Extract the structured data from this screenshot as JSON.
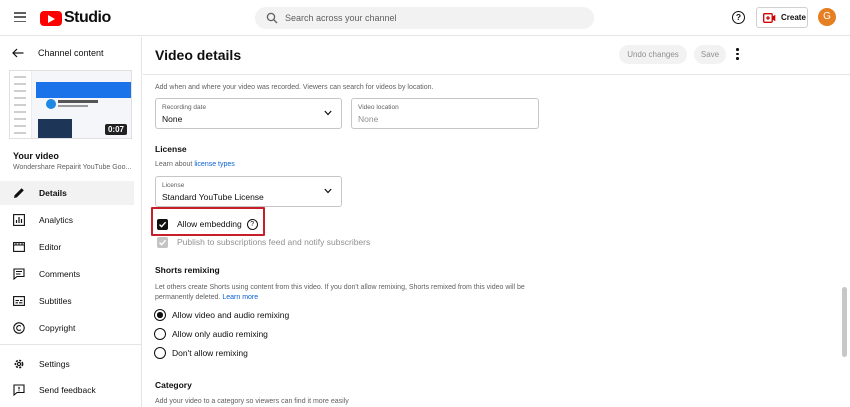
{
  "app": {
    "logo_text": "Studio",
    "search_placeholder": "Search across your channel",
    "create_label": "Create",
    "avatar_letter": "G",
    "help_glyph": "?"
  },
  "sidebar": {
    "back_label": "Channel content",
    "video_duration": "0:07",
    "your_video_label": "Your video",
    "video_name": "Wondershare Repairit YouTube Goo...",
    "items": [
      {
        "label": "Details",
        "icon": "pencil-icon",
        "active": true
      },
      {
        "label": "Analytics",
        "icon": "analytics-icon",
        "active": false
      },
      {
        "label": "Editor",
        "icon": "editor-icon",
        "active": false
      },
      {
        "label": "Comments",
        "icon": "comments-icon",
        "active": false
      },
      {
        "label": "Subtitles",
        "icon": "subtitles-icon",
        "active": false
      },
      {
        "label": "Copyright",
        "icon": "copyright-icon",
        "active": false
      }
    ],
    "footer_items": [
      {
        "label": "Settings",
        "icon": "gear-icon"
      },
      {
        "label": "Send feedback",
        "icon": "feedback-icon"
      }
    ]
  },
  "main": {
    "title": "Video details",
    "undo_label": "Undo changes",
    "save_label": "Save",
    "recording": {
      "description": "Add when and where your video was recorded. Viewers can search for videos by location.",
      "date_label": "Recording date",
      "date_value": "None",
      "location_label": "Video location",
      "location_value": "None"
    },
    "license": {
      "title": "License",
      "learn_prefix": "Learn about ",
      "learn_link": "license types",
      "field_label": "License",
      "field_value": "Standard YouTube License"
    },
    "embedding": {
      "allow_label": "Allow embedding",
      "allow_checked": true,
      "publish_label": "Publish to subscriptions feed and notify subscribers",
      "publish_checked": true
    },
    "shorts": {
      "title": "Shorts remixing",
      "description_line1": "Let others create Shorts using content from this video. If you don't allow remixing, Shorts remixed from this video will be",
      "description_line2": "permanently deleted.",
      "learn_more": "Learn more",
      "options": [
        {
          "label": "Allow video and audio remixing",
          "selected": true
        },
        {
          "label": "Allow only audio remixing",
          "selected": false
        },
        {
          "label": "Don't allow remixing",
          "selected": false
        }
      ]
    },
    "category": {
      "title": "Category",
      "description": "Add your video to a category so viewers can find it more easily"
    }
  }
}
